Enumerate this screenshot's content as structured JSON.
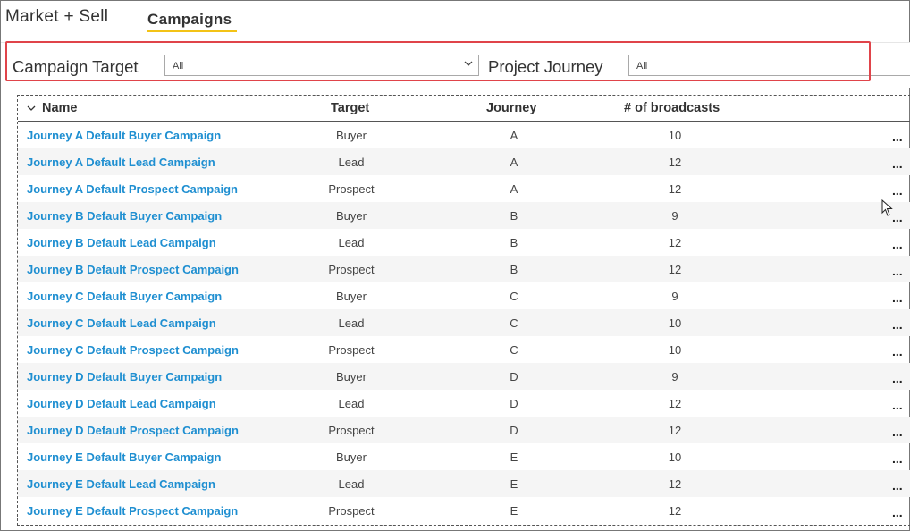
{
  "header": {
    "app_title": "Market + Sell",
    "active_tab": "Campaigns"
  },
  "colors": {
    "tab_underline": "#f3c316",
    "link": "#1f8fd1",
    "highlight_border": "#e0444a"
  },
  "filters": {
    "campaign_target": {
      "label": "Campaign Target",
      "value": "All"
    },
    "project_journey": {
      "label": "Project Journey",
      "value": "All"
    }
  },
  "table": {
    "columns": {
      "name": "Name",
      "target": "Target",
      "journey": "Journey",
      "broadcasts": "# of broadcasts"
    },
    "rows": [
      {
        "name": "Journey A Default Buyer Campaign",
        "target": "Buyer",
        "journey": "A",
        "broadcasts": "10"
      },
      {
        "name": "Journey A Default Lead Campaign",
        "target": "Lead",
        "journey": "A",
        "broadcasts": "12"
      },
      {
        "name": "Journey A Default Prospect Campaign",
        "target": "Prospect",
        "journey": "A",
        "broadcasts": "12"
      },
      {
        "name": "Journey B Default Buyer Campaign",
        "target": "Buyer",
        "journey": "B",
        "broadcasts": "9"
      },
      {
        "name": "Journey B Default Lead Campaign",
        "target": "Lead",
        "journey": "B",
        "broadcasts": "12"
      },
      {
        "name": "Journey B Default Prospect Campaign",
        "target": "Prospect",
        "journey": "B",
        "broadcasts": "12"
      },
      {
        "name": "Journey C Default Buyer Campaign",
        "target": "Buyer",
        "journey": "C",
        "broadcasts": "9"
      },
      {
        "name": "Journey C Default Lead Campaign",
        "target": "Lead",
        "journey": "C",
        "broadcasts": "10"
      },
      {
        "name": "Journey C Default Prospect Campaign",
        "target": "Prospect",
        "journey": "C",
        "broadcasts": "10"
      },
      {
        "name": "Journey D Default Buyer Campaign",
        "target": "Buyer",
        "journey": "D",
        "broadcasts": "9"
      },
      {
        "name": "Journey D Default Lead Campaign",
        "target": "Lead",
        "journey": "D",
        "broadcasts": "12"
      },
      {
        "name": "Journey D Default Prospect Campaign",
        "target": "Prospect",
        "journey": "D",
        "broadcasts": "12"
      },
      {
        "name": "Journey E Default Buyer Campaign",
        "target": "Buyer",
        "journey": "E",
        "broadcasts": "10"
      },
      {
        "name": "Journey E Default Lead Campaign",
        "target": "Lead",
        "journey": "E",
        "broadcasts": "12"
      },
      {
        "name": "Journey E Default Prospect Campaign",
        "target": "Prospect",
        "journey": "E",
        "broadcasts": "12"
      }
    ],
    "row_menu_label": "..."
  }
}
